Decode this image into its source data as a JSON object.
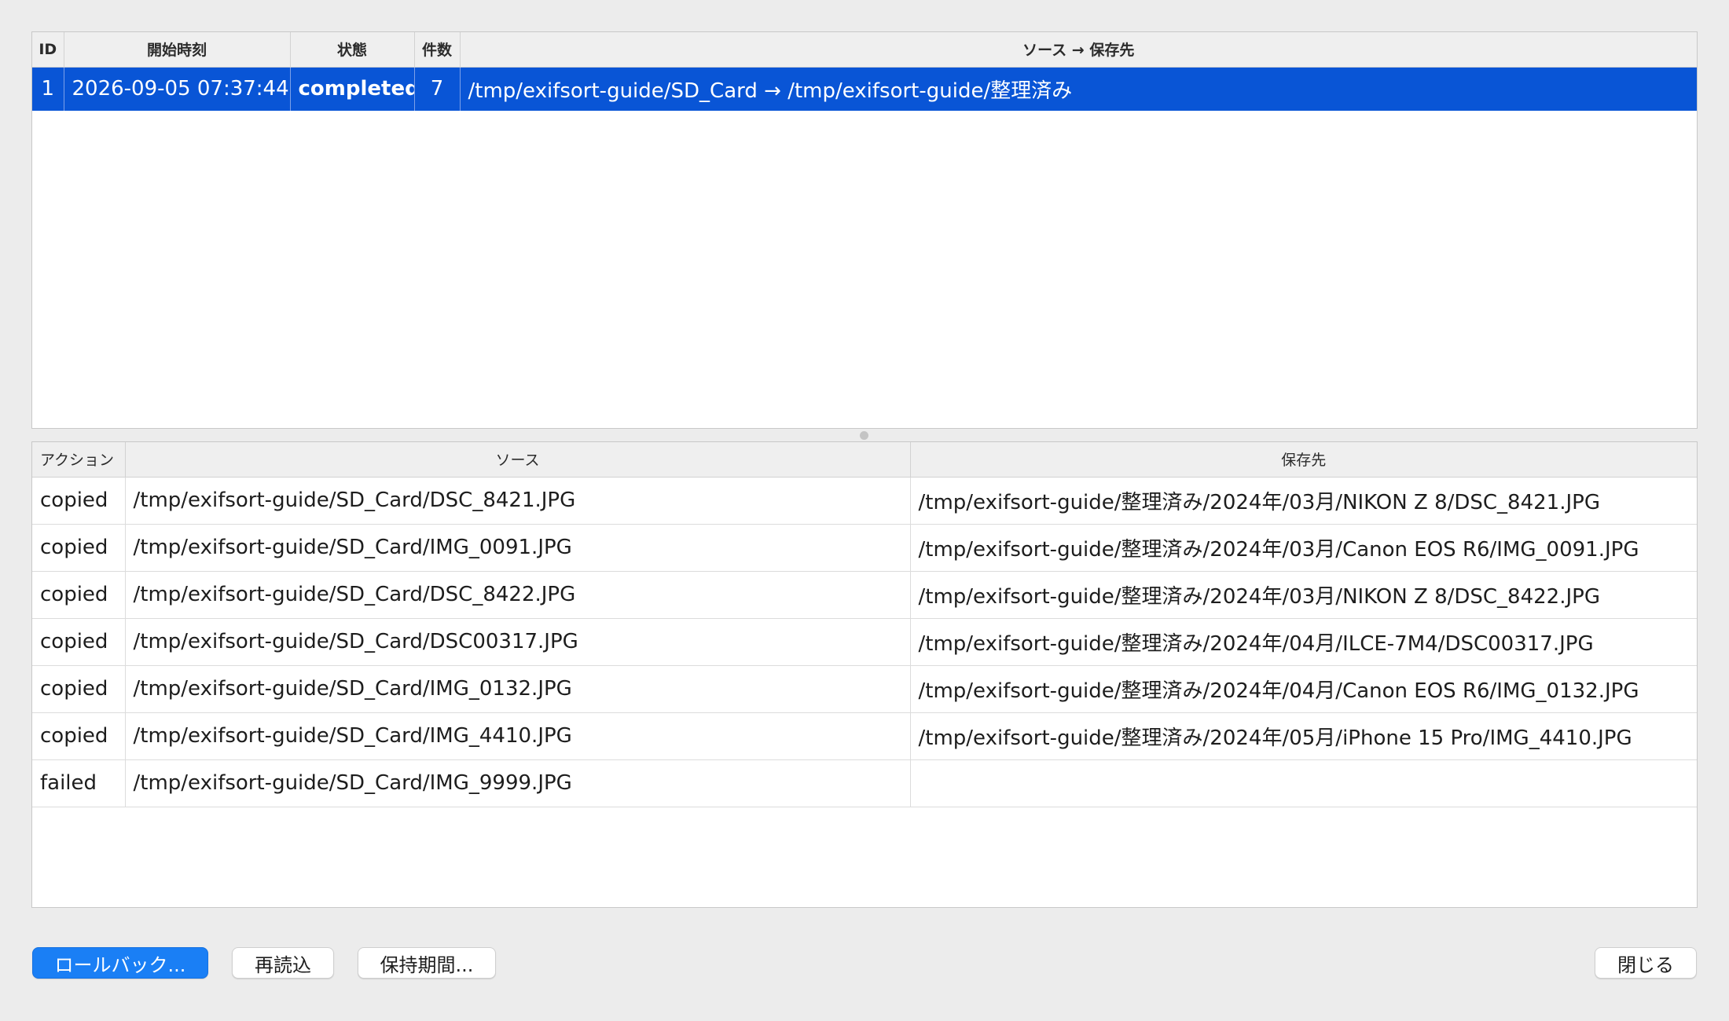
{
  "runs": {
    "columns": {
      "id": "ID",
      "start_time": "開始時刻",
      "status": "状態",
      "count": "件数",
      "source_dest": "ソース → 保存先"
    },
    "rows": [
      {
        "id": "1",
        "start_time": "2026-09-05 07:37:44",
        "status": "completed",
        "count": "7",
        "source_dest": "/tmp/exifsort-guide/SD_Card → /tmp/exifsort-guide/整理済み",
        "selected": true
      }
    ]
  },
  "operations": {
    "columns": {
      "action": "アクション",
      "source": "ソース",
      "destination": "保存先"
    },
    "rows": [
      {
        "action": "copied",
        "source": "/tmp/exifsort-guide/SD_Card/DSC_8421.JPG",
        "destination": "/tmp/exifsort-guide/整理済み/2024年/03月/NIKON Z 8/DSC_8421.JPG"
      },
      {
        "action": "copied",
        "source": "/tmp/exifsort-guide/SD_Card/IMG_0091.JPG",
        "destination": "/tmp/exifsort-guide/整理済み/2024年/03月/Canon EOS R6/IMG_0091.JPG"
      },
      {
        "action": "copied",
        "source": "/tmp/exifsort-guide/SD_Card/DSC_8422.JPG",
        "destination": "/tmp/exifsort-guide/整理済み/2024年/03月/NIKON Z 8/DSC_8422.JPG"
      },
      {
        "action": "copied",
        "source": "/tmp/exifsort-guide/SD_Card/DSC00317.JPG",
        "destination": "/tmp/exifsort-guide/整理済み/2024年/04月/ILCE-7M4/DSC00317.JPG"
      },
      {
        "action": "copied",
        "source": "/tmp/exifsort-guide/SD_Card/IMG_0132.JPG",
        "destination": "/tmp/exifsort-guide/整理済み/2024年/04月/Canon EOS R6/IMG_0132.JPG"
      },
      {
        "action": "copied",
        "source": "/tmp/exifsort-guide/SD_Card/IMG_4410.JPG",
        "destination": "/tmp/exifsort-guide/整理済み/2024年/05月/iPhone 15 Pro/IMG_4410.JPG"
      },
      {
        "action": "failed",
        "source": "/tmp/exifsort-guide/SD_Card/IMG_9999.JPG",
        "destination": ""
      }
    ]
  },
  "buttons": {
    "rollback": "ロールバック...",
    "reload": "再読込",
    "retention": "保持期間...",
    "close": "閉じる"
  },
  "colors": {
    "selection": "#0955d6",
    "primary_button": "#1a7ff5"
  }
}
